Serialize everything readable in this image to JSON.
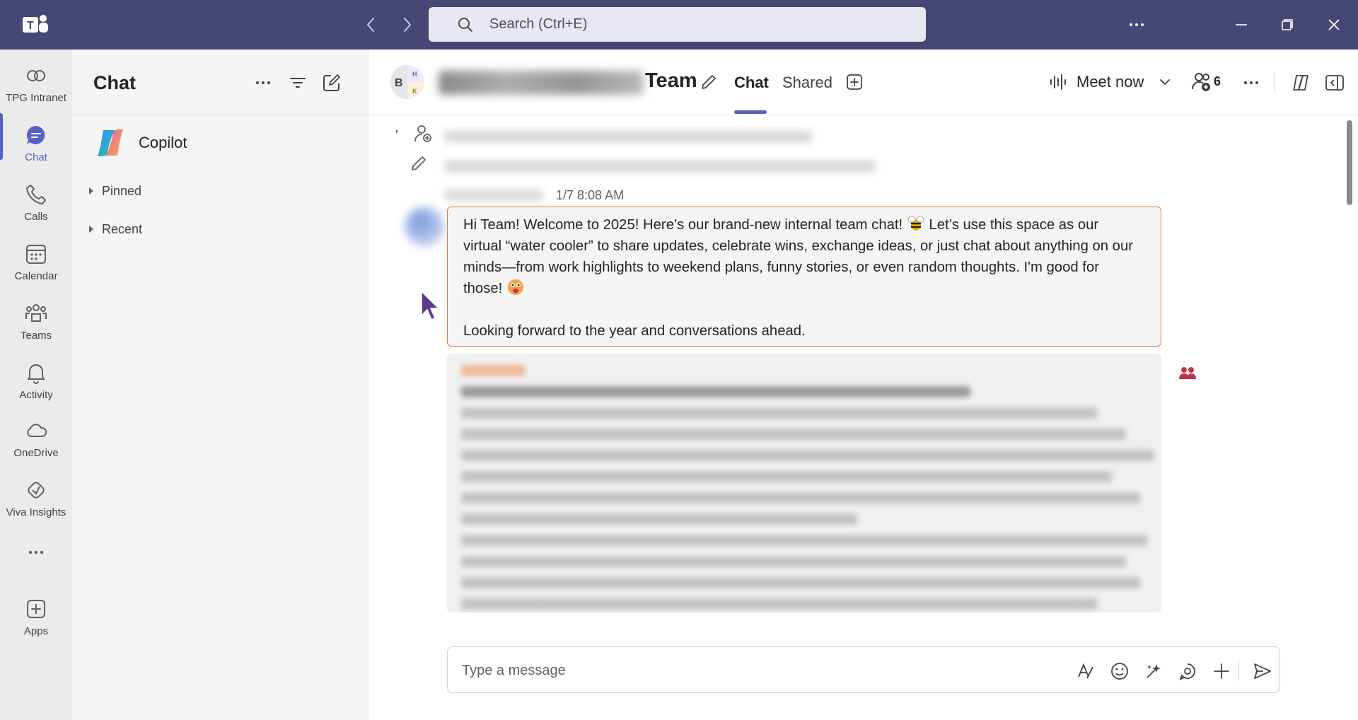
{
  "titlebar": {
    "search_placeholder": "Search (Ctrl+E)",
    "icons": [
      "teams-logo-icon",
      "back-arrow-icon",
      "forward-arrow-icon",
      "search-icon",
      "more-icon",
      "minimize-icon",
      "restore-icon",
      "close-icon"
    ]
  },
  "rail": {
    "items": [
      {
        "label": "TPG Intranet",
        "icon": "intranet-icon"
      },
      {
        "label": "Chat",
        "icon": "chat-icon"
      },
      {
        "label": "Calls",
        "icon": "phone-icon"
      },
      {
        "label": "Calendar",
        "icon": "calendar-icon"
      },
      {
        "label": "Teams",
        "icon": "teams-icon"
      },
      {
        "label": "Activity",
        "icon": "bell-icon"
      },
      {
        "label": "OneDrive",
        "icon": "cloud-icon"
      },
      {
        "label": "Viva Insights",
        "icon": "heart-icon"
      },
      {
        "label": "",
        "icon": "more-apps-icon"
      },
      {
        "label": "Apps",
        "icon": "add-apps-icon"
      }
    ],
    "active": "Chat"
  },
  "list_pane": {
    "title": "Chat",
    "copilot": "Copilot",
    "sections": [
      "Pinned",
      "Recent"
    ]
  },
  "conversation": {
    "avatar_letters": [
      "B",
      "H",
      "K"
    ],
    "title": "Team",
    "tabs": {
      "chat": "Chat",
      "shared": "Shared"
    },
    "meet_now": "Meet now",
    "participant_count": "6",
    "message": {
      "timestamp": "1/7 8:08 AM",
      "line1": "Hi Team!  Welcome to 2025!  Here’s our brand-new internal team chat! ",
      "line1b": " Let’s use this space as our",
      "line2": "virtual “water cooler” to share updates, celebrate wins, exchange ideas, or just chat about anything on our",
      "line3": "minds—from work highlights to weekend plans, funny stories, or even random thoughts.  I'm good for",
      "line4": "those!  ",
      "line5": "Looking forward to the year and conversations ahead."
    },
    "compose_placeholder": "Type a message"
  },
  "colors": {
    "titlebar": "#464775",
    "accent": "#5b5fc7",
    "highlight_border": "#e0773c"
  }
}
